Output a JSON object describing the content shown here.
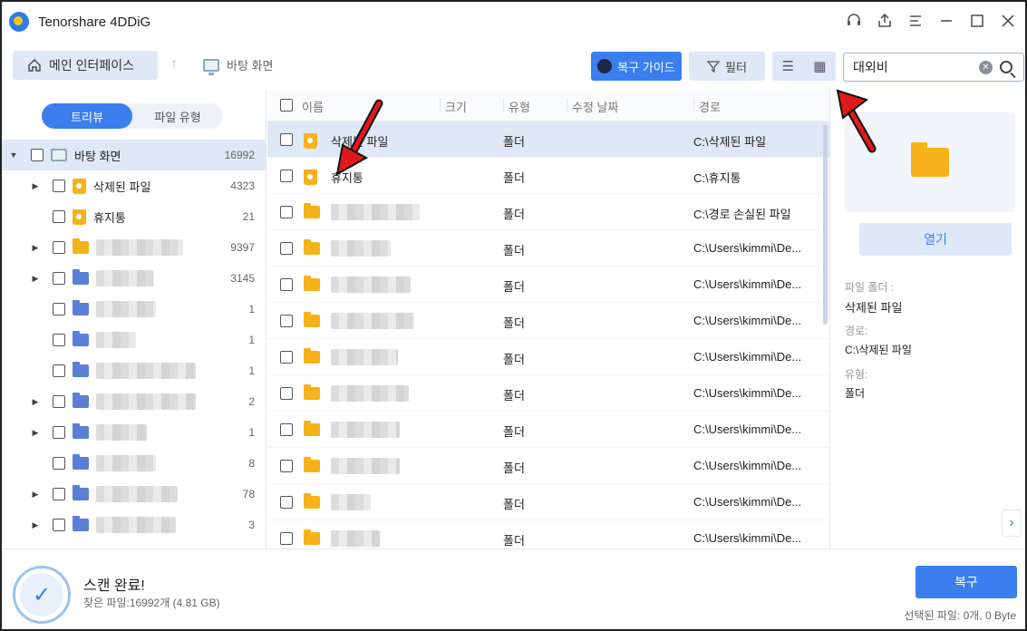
{
  "app": {
    "title": "Tenorshare 4DDiG"
  },
  "toolbar": {
    "home_label": "메인 인터페이스",
    "breadcrumb": "바탕 화면",
    "guide_label": "복구 가이드",
    "filter_label": "필터",
    "search_value": "대외비"
  },
  "left": {
    "tabs": [
      "트리뷰",
      "파일 유형"
    ],
    "root": {
      "label": "바탕 화면",
      "count": "16992"
    },
    "items": [
      {
        "label": "삭제된 파일",
        "count": "4323",
        "icon": "deleted-folder-icon"
      },
      {
        "label": "휴지통",
        "count": "21",
        "icon": "recycle-bin-icon"
      },
      {
        "label": "",
        "count": "9397"
      },
      {
        "label": "",
        "count": "3145"
      },
      {
        "label": "",
        "count": "1"
      },
      {
        "label": "",
        "count": "1"
      },
      {
        "label": "",
        "count": "1"
      },
      {
        "label": "",
        "count": "2"
      },
      {
        "label": "",
        "count": "1"
      },
      {
        "label": "",
        "count": "8"
      },
      {
        "label": "",
        "count": "78"
      },
      {
        "label": "",
        "count": "3"
      }
    ]
  },
  "list": {
    "columns": [
      "이름",
      "크기",
      "유형",
      "수정 날짜",
      "경로"
    ],
    "rows": [
      {
        "name": "삭제된 파일",
        "type": "폴더",
        "path": "C:\\삭제된 파일"
      },
      {
        "name": "휴지통",
        "type": "폴더",
        "path": "C:\\휴지통"
      },
      {
        "name": "",
        "type": "폴더",
        "path": "C:\\경로 손실된 파일"
      },
      {
        "name": "",
        "type": "폴더",
        "path": "C:\\Users\\kimmi\\De..."
      },
      {
        "name": "",
        "type": "폴더",
        "path": "C:\\Users\\kimmi\\De..."
      },
      {
        "name": "",
        "type": "폴더",
        "path": "C:\\Users\\kimmi\\De..."
      },
      {
        "name": "",
        "type": "폴더",
        "path": "C:\\Users\\kimmi\\De..."
      },
      {
        "name": "",
        "type": "폴더",
        "path": "C:\\Users\\kimmi\\De..."
      },
      {
        "name": "",
        "type": "폴더",
        "path": "C:\\Users\\kimmi\\De..."
      },
      {
        "name": "",
        "type": "폴더",
        "path": "C:\\Users\\kimmi\\De..."
      },
      {
        "name": "",
        "type": "폴더",
        "path": "C:\\Users\\kimmi\\De..."
      },
      {
        "name": "",
        "type": "폴더",
        "path": "C:\\Users\\kimmi\\De..."
      }
    ]
  },
  "details": {
    "open_label": "열기",
    "folder_label": "파일 폴더 :",
    "folder_value": "삭제된 파일",
    "path_label": "경로:",
    "path_value": "C:\\삭제된 파일",
    "type_label": "유형:",
    "type_value": "폴더"
  },
  "footer": {
    "scan_title": "스캔 완료!",
    "scan_sub": "찾은 파일:16992개 (4.81 GB)",
    "recover_label": "복구",
    "selected_info": "선택된 파일: 0개, 0 Byte"
  },
  "colors": {
    "accent": "#3b7ef0",
    "selected_bg": "#dfe8f7",
    "folder": "#f6b21a",
    "annotation": "#e0191b"
  }
}
